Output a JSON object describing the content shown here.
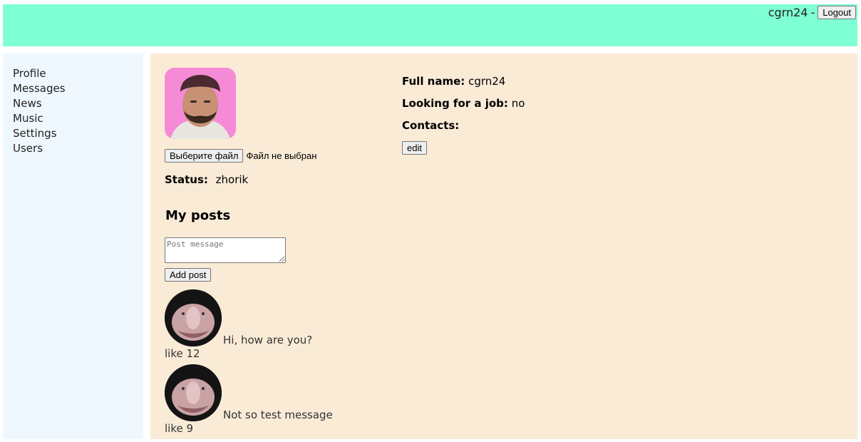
{
  "header": {
    "login": "cgrn24",
    "separator": "-",
    "logout_label": "Logout"
  },
  "sidebar": {
    "items": [
      {
        "label": "Profile"
      },
      {
        "label": "Messages"
      },
      {
        "label": "News"
      },
      {
        "label": "Music"
      },
      {
        "label": "Settings"
      },
      {
        "label": "Users"
      }
    ]
  },
  "profile": {
    "file_button_label": "Выберите файл",
    "file_status": "Файл не выбран",
    "status_label": "Status:",
    "status_value": "zhorik",
    "full_name_label": "Full name:",
    "full_name_value": "cgrn24",
    "job_label": "Looking for a job:",
    "job_value": "no",
    "contacts_label": "Contacts:",
    "edit_label": "edit"
  },
  "posts": {
    "title": "My posts",
    "input_placeholder": "Post message",
    "add_label": "Add post",
    "items": [
      {
        "message": "Hi, how are you?",
        "likes": "like 12"
      },
      {
        "message": "Not so test message",
        "likes": "like 9"
      }
    ]
  },
  "colors": {
    "header_bg": "#7fffd4",
    "sidebar_bg": "#f0f8ff",
    "content_bg": "#faebd7"
  }
}
